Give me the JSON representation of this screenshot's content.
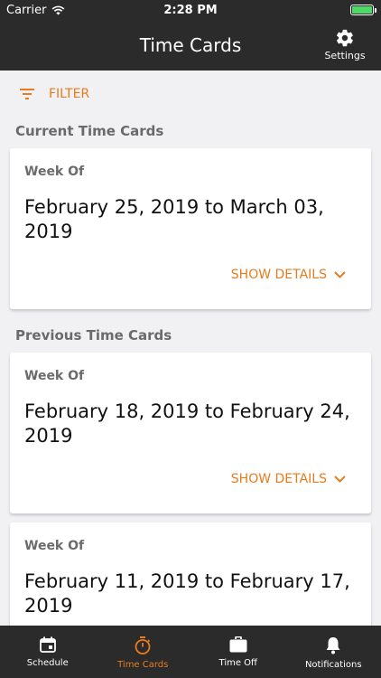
{
  "status_bar": {
    "carrier": "Carrier",
    "time": "2:28 PM",
    "battery_color": "#4cd964"
  },
  "header": {
    "title": "Time Cards",
    "settings_label": "Settings",
    "settings_icon": "gear-icon"
  },
  "filter": {
    "label": "FILTER",
    "icon": "filter-lines-icon"
  },
  "sections": {
    "current": {
      "title": "Current Time Cards",
      "cards": [
        {
          "week_label": "Week Of",
          "range": "February 25, 2019 to March 03, 2019",
          "details_label": "SHOW DETAILS"
        }
      ]
    },
    "previous": {
      "title": "Previous Time Cards",
      "cards": [
        {
          "week_label": "Week Of",
          "range": "February 18, 2019 to February 24, 2019",
          "details_label": "SHOW DETAILS"
        },
        {
          "week_label": "Week Of",
          "range": "February 11, 2019 to February 17, 2019"
        }
      ]
    }
  },
  "tabs": [
    {
      "label": "Schedule",
      "icon": "calendar-icon",
      "active": false
    },
    {
      "label": "Time Cards",
      "icon": "stopwatch-icon",
      "active": true
    },
    {
      "label": "Time Off",
      "icon": "briefcase-icon",
      "active": false
    },
    {
      "label": "Notifications",
      "icon": "bell-icon",
      "active": false
    }
  ],
  "colors": {
    "accent": "#e87b1e",
    "bar_background": "#2b2b2b",
    "page_background": "#f1f1f3"
  }
}
